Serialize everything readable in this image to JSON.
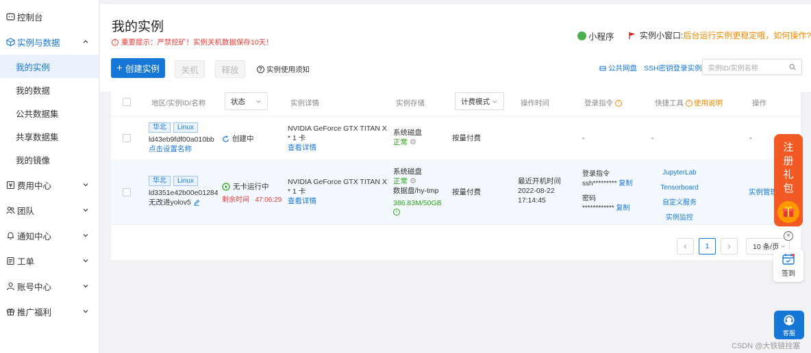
{
  "sidebar": {
    "console": "控制台",
    "instances_data": "实例与数据",
    "sub": [
      "我的实例",
      "我的数据",
      "公共数据集",
      "共享数据集",
      "我的镜像"
    ],
    "items": [
      "费用中心",
      "团队",
      "通知中心",
      "工单",
      "账号中心",
      "推广福利"
    ]
  },
  "header": {
    "title": "我的实例",
    "warning": "重要提示：严禁挖矿！实例关机数据保存10天！",
    "mini_program": "小程序",
    "window_label": "实例小窗口:",
    "window_link": "后台运行实例更稳定哦，如何操作?"
  },
  "toolbar": {
    "create": "创建实例",
    "shutdown": "关机",
    "release": "释放",
    "notice": "实例使用须知",
    "public_disk": "公共网盘",
    "ssh_login": "SSH密钥登录实例",
    "search_placeholder": "实例ID/实例名称"
  },
  "table": {
    "headers": {
      "region": "地区/实例ID/名称",
      "status": "状态",
      "details": "实例详情",
      "storage": "实例存储",
      "billing": "计费模式",
      "op_time": "操作时间",
      "login": "登录指令",
      "tools": "快捷工具",
      "usage": "使用说明",
      "ops": "操作"
    },
    "rows": [
      {
        "region": "华北",
        "os": "Linux",
        "id": "ld43eb9fdf00a010bb",
        "name": "点击设置名称",
        "status": "创建中",
        "gpu1": "NVIDIA GeForce GTX TITAN X",
        "gpu2": "* 1 卡",
        "details_link": "查看详情",
        "disk": "系统磁盘",
        "disk_status": "正常",
        "billing": "按量付费",
        "login": "-",
        "tools": "-",
        "ops": "-"
      },
      {
        "region": "华北",
        "os": "Linux",
        "id": "ld3351e42b00e01284",
        "name": "无改进yolov5",
        "status": "无卡运行中",
        "remaining_label": "剩余时间",
        "remaining": "47:06:29",
        "gpu1": "NVIDIA GeForce GTX TITAN X",
        "gpu2": "* 1 卡",
        "details_link": "查看详情",
        "disk": "系统磁盘",
        "disk_status": "正常",
        "data_disk": "数据盘/hy-tmp",
        "data_usage": "386.83M/50GB",
        "billing": "按量付费",
        "last_boot_label": "最近开机时间",
        "last_boot_date": "2022-08-22",
        "last_boot_time": "17:14:45",
        "login_label": "登录指令",
        "login_value": "ssh*********",
        "copy": "复制",
        "password_label": "密码",
        "password_value": "************",
        "tools": [
          "JupyterLab",
          "Tensorboard",
          "自定义服务",
          "实例监控"
        ],
        "ops": "实例管理"
      }
    ]
  },
  "pagination": {
    "current": "1",
    "page_size": "10 条/页"
  },
  "floating": {
    "register": [
      "注",
      "册",
      "礼",
      "包"
    ],
    "signin": "签到",
    "service": "客服"
  },
  "watermark": "CSDN @大铁链拴塞"
}
